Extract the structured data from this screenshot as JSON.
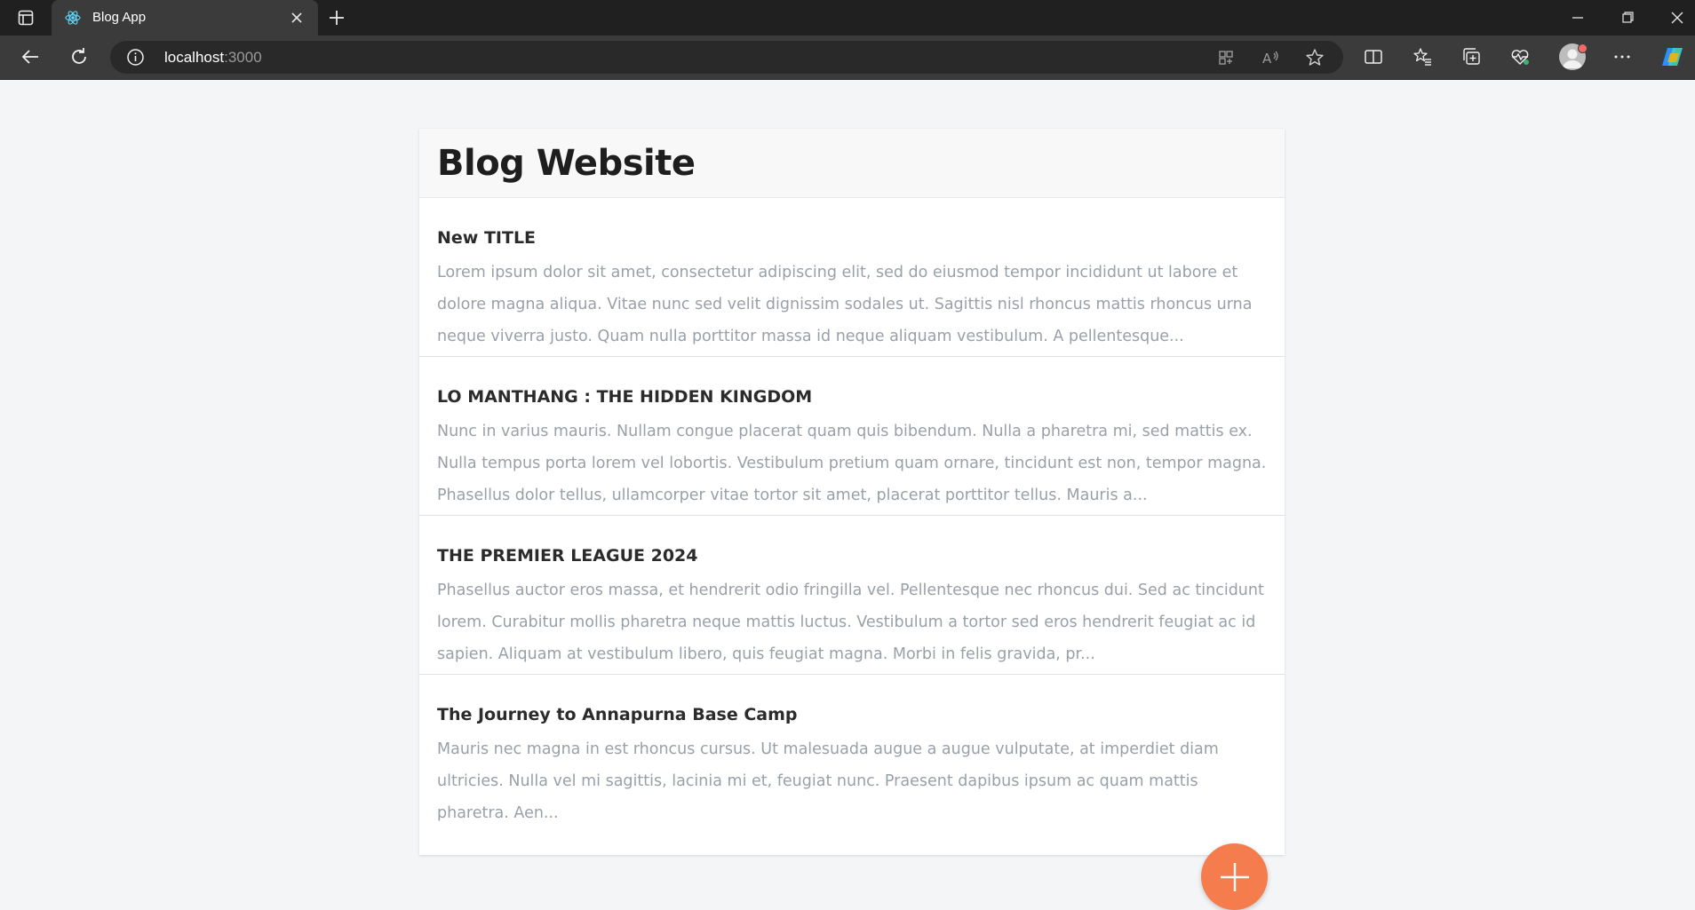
{
  "browser": {
    "tab_title": "Blog App",
    "url_host": "localhost",
    "url_port": ":3000"
  },
  "blog": {
    "title": "Blog Website",
    "posts": [
      {
        "title": "New TITLE",
        "excerpt": "Lorem ipsum dolor sit amet, consectetur adipiscing elit, sed do eiusmod tempor incididunt ut labore et dolore magna aliqua. Vitae nunc sed velit dignissim sodales ut. Sagittis nisl rhoncus mattis rhoncus urna neque viverra justo. Quam nulla porttitor massa id neque aliquam vestibulum. A pellentesque..."
      },
      {
        "title": "LO MANTHANG : THE HIDDEN KINGDOM",
        "excerpt": "Nunc in varius mauris. Nullam congue placerat quam quis bibendum. Nulla a pharetra mi, sed mattis ex. Nulla tempus porta lorem vel lobortis. Vestibulum pretium quam ornare, tincidunt est non, tempor magna. Phasellus dolor tellus, ullamcorper vitae tortor sit amet, placerat porttitor tellus. Mauris a..."
      },
      {
        "title": "THE PREMIER LEAGUE 2024",
        "excerpt": "Phasellus auctor eros massa, et hendrerit odio fringilla vel. Pellentesque nec rhoncus dui. Sed ac tincidunt lorem. Curabitur mollis pharetra neque mattis luctus. Vestibulum a tortor sed eros hendrerit feugiat ac id sapien. Aliquam at vestibulum libero, quis feugiat magna. Morbi in felis gravida, pr..."
      },
      {
        "title": "The Journey to Annapurna Base Camp",
        "excerpt": "Mauris nec magna in est rhoncus cursus. Ut malesuada augue a augue vulputate, at imperdiet diam ultricies. Nulla vel mi sagittis, lacinia mi et, feugiat nunc. Praesent dapibus ipsum ac quam mattis pharetra. Aen..."
      }
    ]
  },
  "colors": {
    "fab": "#f47c4d",
    "page_bg": "#f3f5f7"
  }
}
